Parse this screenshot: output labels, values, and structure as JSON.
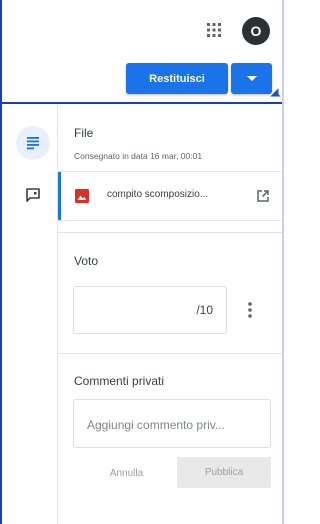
{
  "header": {
    "apps_icon": "grid-apps-icon",
    "avatar_initial": "O",
    "return_label": "Restituisci",
    "dropdown_icon": "caret-down-icon"
  },
  "rail": {
    "file_tab_icon": "notes-icon",
    "feedback_tab_icon": "comment-feedback-icon"
  },
  "file_section": {
    "title": "File",
    "submitted": "Consegnato in data 16 mar, 00:01",
    "attachment": {
      "name": "compito scomposizio...",
      "icon": "image-file-icon",
      "open_icon": "open-in-new-icon"
    }
  },
  "grade_section": {
    "title": "Voto",
    "value": "/10",
    "more_icon": "more-vert-icon"
  },
  "comments_section": {
    "title": "Commenti privati",
    "placeholder": "Aggiungi commento priv...",
    "cancel_label": "Annulla",
    "publish_label": "Pubblica"
  },
  "colors": {
    "accent": "#1a73e8",
    "frame": "#1a3fb5",
    "file_icon": "#d93025"
  }
}
